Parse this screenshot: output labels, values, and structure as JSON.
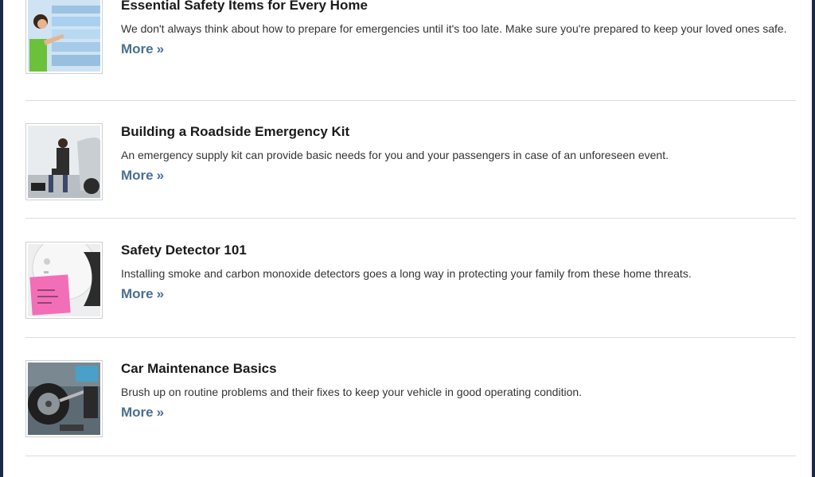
{
  "articles": [
    {
      "title": "Essential Safety Items for Every Home",
      "description": "We don't always think about how to prepare for emergencies until it's too late. Make sure you're prepared to keep your loved ones safe.",
      "more": "More",
      "more_arrow": "»",
      "image_icon": "woman-shopping-image"
    },
    {
      "title": "Building a Roadside Emergency Kit",
      "description": "An emergency supply kit can provide basic needs for you and your passengers in case of an unforeseen event.",
      "more": "More",
      "more_arrow": "»",
      "image_icon": "roadside-man-image"
    },
    {
      "title": "Safety Detector 101",
      "description": "Installing smoke and carbon monoxide detectors goes a long way in protecting your family from these home threats.",
      "more": "More",
      "more_arrow": "»",
      "image_icon": "smoke-detector-image"
    },
    {
      "title": "Car Maintenance Basics",
      "description": "Brush up on routine problems and their fixes to keep your vehicle in good operating condition.",
      "more": "More",
      "more_arrow": "»",
      "image_icon": "tire-change-image"
    }
  ],
  "colors": {
    "frame": "#1c2a4a",
    "link": "#4a6f93",
    "divider": "#dcdcdc"
  }
}
